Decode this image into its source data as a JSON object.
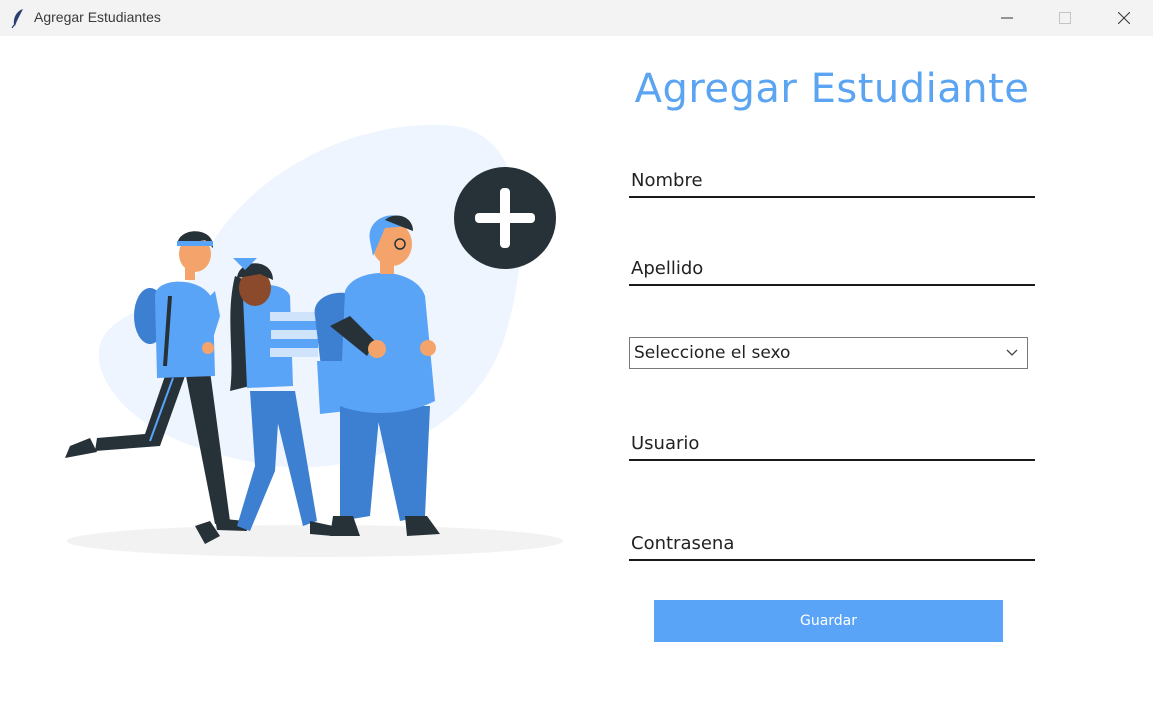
{
  "window": {
    "title": "Agregar Estudiantes"
  },
  "icons": {
    "app": "feather-icon",
    "minimize": "minimize-icon",
    "maximize": "maximize-icon",
    "close": "close-icon",
    "chevron": "chevron-down-icon",
    "plus": "plus-circle-icon"
  },
  "colors": {
    "accent": "#5aa4f7",
    "title": "#5aa4f2",
    "blob": "#eef5fe",
    "dark": "#263238"
  },
  "form": {
    "title": "Agregar Estudiante",
    "nombre": {
      "placeholder": "Nombre",
      "value": ""
    },
    "apellido": {
      "placeholder": "Apellido",
      "value": ""
    },
    "sexo": {
      "selected": "Seleccione el sexo"
    },
    "usuario": {
      "placeholder": "Usuario",
      "value": ""
    },
    "contrasena": {
      "placeholder": "Contrasena",
      "value": ""
    },
    "save_label": "Guardar"
  }
}
